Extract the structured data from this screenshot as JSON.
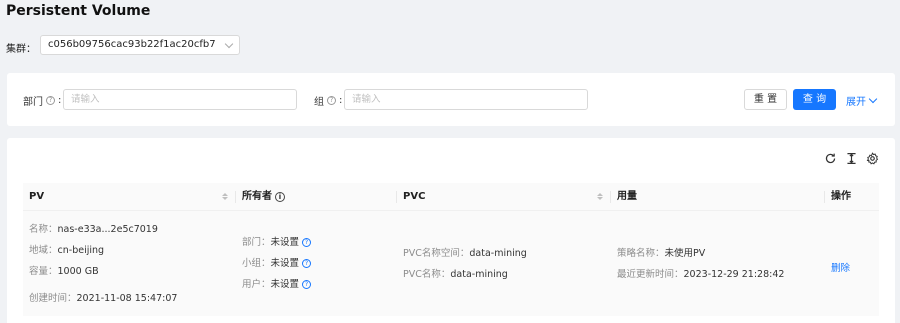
{
  "page": {
    "title": "Persistent Volume"
  },
  "cluster": {
    "label": "集群：",
    "value": "c056b09756cac93b22f1ac20cfb7"
  },
  "filters": {
    "department": {
      "label": "部门",
      "placeholder": "请输入"
    },
    "group": {
      "label": "组",
      "placeholder": "请输入"
    },
    "reset_label": "重 置",
    "query_label": "查 询",
    "expand_label": "展开"
  },
  "table": {
    "columns": {
      "pv": "PV",
      "owner": "所有者",
      "pvc": "PVC",
      "usage": "用量",
      "actions": "操作"
    },
    "rows": [
      {
        "pv": {
          "name_label": "名称：",
          "name": "nas-e33a...2e5c7019",
          "region_label": "地域：",
          "region": "cn-beijing",
          "capacity_label": "容量：",
          "capacity": "1000 GB",
          "created_label": "创建时间：",
          "created": "2021-11-08 15:47:07"
        },
        "owner": {
          "dept_label": "部门：",
          "dept": "未设置",
          "group_label": "小组：",
          "group": "未设置",
          "user_label": "用户：",
          "user": "未设置"
        },
        "pvc": {
          "ns_label": "PVC名称空间：",
          "ns": "data-mining",
          "name_label": "PVC名称：",
          "name": "data-mining"
        },
        "usage": {
          "policy_label": "策略名称：",
          "policy": "未使用PV",
          "updated_label": "最近更新时间：",
          "updated": "2023-12-29 21:28:42"
        },
        "action_label": "删除"
      }
    ]
  },
  "colors": {
    "primary": "#1677ff",
    "background": "#f0f2f5"
  }
}
